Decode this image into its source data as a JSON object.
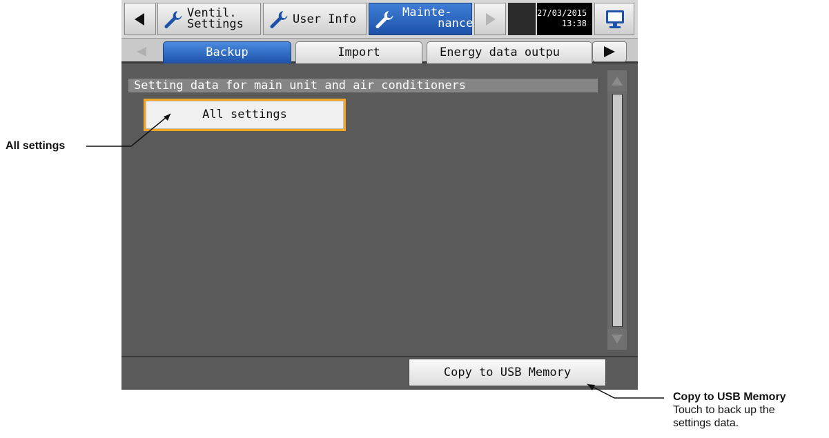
{
  "top_tabs": {
    "ventil_settings": "Ventil.\nSettings",
    "user_info": "User Info",
    "maintenance": "Mainte-\n     nance"
  },
  "datetime": {
    "date": "27/03/2015",
    "time": "13:38"
  },
  "sub_tabs": [
    "Backup",
    "Import",
    "Energy data outpu"
  ],
  "section_title": "Setting data for main unit and air conditioners",
  "all_settings_label": "All settings",
  "copy_button_label": "Copy to USB Memory",
  "annotations": {
    "all_settings": "All settings",
    "copy_title": "Copy to USB Memory",
    "copy_line1": "Touch to back up the",
    "copy_line2": "settings data."
  },
  "colors": {
    "accent_blue": "#1d52a8",
    "highlight_orange": "#f5a623",
    "panel_gray": "#5a5a5a"
  },
  "icons": [
    "left-arrow-icon",
    "wrench-icon",
    "right-arrow-icon",
    "monitor-icon",
    "scroll-up-icon",
    "scroll-down-icon"
  ]
}
